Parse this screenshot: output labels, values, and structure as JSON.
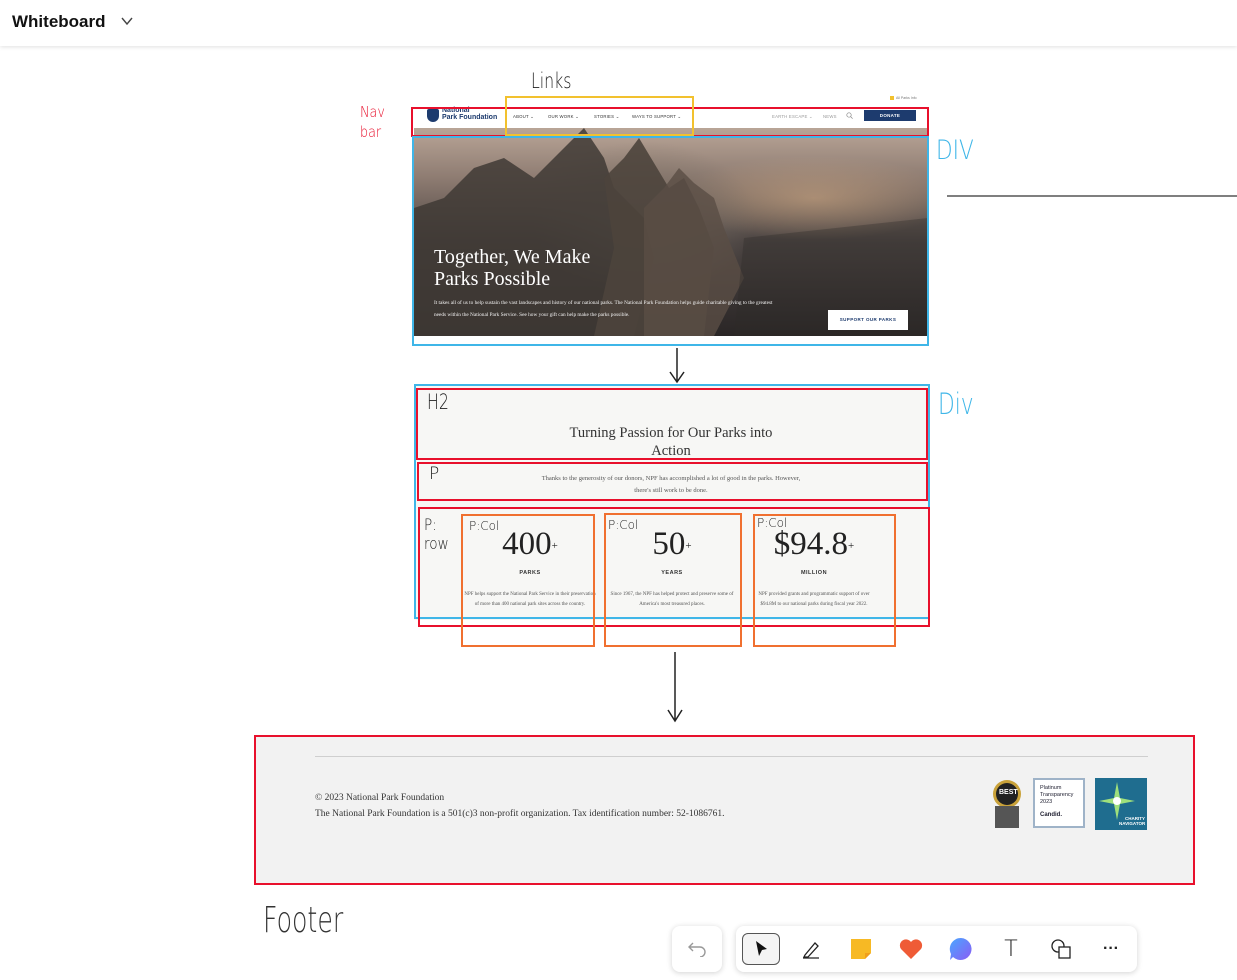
{
  "app": {
    "title": "Whiteboard"
  },
  "annotations": {
    "links": "Links",
    "nav_bar": "Nav bar",
    "div1": "DIV",
    "div2": "Div",
    "h2": "H2",
    "p": "P",
    "p_row": "P: row",
    "p_col": "P:Col",
    "footer": "Footer"
  },
  "website": {
    "top_link": "All Parks Info",
    "logo_line1": "National",
    "logo_line2": "Park Foundation",
    "nav_links": [
      "ABOUT ⌄",
      "OUR WORK ⌄",
      "STORIES ⌄",
      "WAYS TO SUPPORT ⌄"
    ],
    "nav_right": [
      "EARTH ESCAPE ⌄",
      "NEWS"
    ],
    "donate": "DONATE",
    "hero_title": "Together, We Make Parks Possible",
    "hero_desc": "It takes all of us to help sustain the vast landscapes and history of our national parks. The National Park Foundation helps guide charitable giving to the greatest needs within the National Park Service. See how your gift can help make the parks possible.",
    "hero_button": "SUPPORT OUR PARKS",
    "h2": "Turning Passion for Our Parks into Action",
    "intro": "Thanks to the generosity of our donors, NPF has accomplished a lot of good in the parks. However, there's still work to be done.",
    "stats": [
      {
        "value": "400",
        "suffix": "+",
        "label": "PARKS",
        "desc": "NPF helps support the National Park Service in their preservation of more than 400 national park sites across the country."
      },
      {
        "value": "50",
        "suffix": "+",
        "label": "YEARS",
        "desc": "Since 1967, the NPF has helped protect and preserve some of America's most treasured places."
      },
      {
        "value": "$94.8",
        "suffix": "+",
        "label": "MILLION",
        "desc": "NPF provided grants and programmatic support of over $94.8M to our national parks during fiscal year 2022."
      }
    ],
    "footer_copyright": "© 2023 National Park Foundation",
    "footer_tax": "The National Park Foundation is a 501(c)3 non-profit organization. Tax identification number: 52-1086761.",
    "badges": {
      "best": "BEST",
      "candid_line1": "Platinum",
      "candid_line2": "Transparency",
      "candid_year": "2023",
      "candid_name": "Candid.",
      "charity_nav": "CHARITY NAVIGATOR"
    }
  },
  "colors": {
    "red": "#e8102c",
    "blue": "#3fb6e8",
    "yellow": "#f2c12e",
    "orange": "#f07030",
    "navy": "#1d3b6e"
  },
  "toolbar": {
    "tools": [
      "undo-icon",
      "select-icon",
      "pen-icon",
      "sticky-note-icon",
      "reaction-icon",
      "comment-icon",
      "text-icon",
      "shapes-icon",
      "more-icon"
    ],
    "text_glyph": "T",
    "more_glyph": "···"
  }
}
